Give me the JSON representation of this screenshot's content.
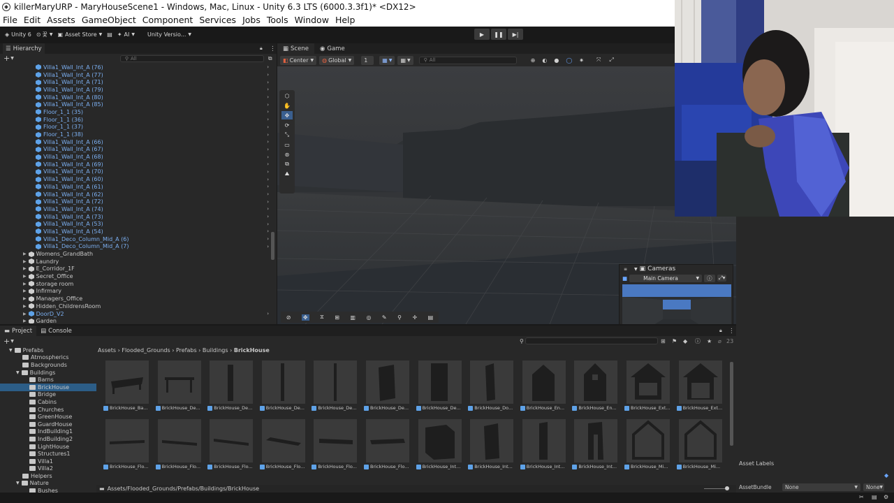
{
  "window": {
    "title": "killerMaryURP - MaryHouseScene1 - Windows, Mac, Linux - Unity 6.3 LTS (6000.3.3f1)* <DX12>"
  },
  "menu": [
    "File",
    "Edit",
    "Assets",
    "GameObject",
    "Component",
    "Services",
    "Jobs",
    "Tools",
    "Window",
    "Help"
  ],
  "toolbar": {
    "account": "Unity 6",
    "account_extra": "꽃",
    "asset_store": "Asset Store",
    "ai": "AI",
    "version_control": "Unity Versio..."
  },
  "hierarchy": {
    "tab": "Hierarchy",
    "search_placeholder": "All",
    "prefab_rows": [
      "Villa1_Wall_Int_A (76)",
      "Villa1_Wall_Int_A (77)",
      "Villa1_Wall_Int_A (71)",
      "Villa1_Wall_Int_A (79)",
      "Villa1_Wall_Int_A (80)",
      "Villa1_Wall_Int_A (85)",
      "Floor_1_1 (35)",
      "Floor_1_1 (36)",
      "Floor_1_1 (37)",
      "Floor_1_1 (38)",
      "Villa1_Wall_Int_A (66)",
      "Villa1_Wall_Int_A (67)",
      "Villa1_Wall_Int_A (68)",
      "Villa1_Wall_Int_A (69)",
      "Villa1_Wall_Int_A (70)",
      "Villa1_Wall_Int_A (60)",
      "Villa1_Wall_Int_A (61)",
      "Villa1_Wall_Int_A (62)",
      "Villa1_Wall_Int_A (72)",
      "Villa1_Wall_Int_A (74)",
      "Villa1_Wall_Int_A (73)",
      "Villa1_Wall_Int_A (53)",
      "Villa1_Wall_Int_A (54)",
      "Villa1_Deco_Column_Mid_A (6)",
      "Villa1_Deco_Column_Mid_A (7)"
    ],
    "object_rows": [
      "Womens_GrandBath",
      "Laundry",
      "E_Corridor_1F",
      "Secret_Office",
      "storage room",
      "Infirmary",
      "Managers_Office",
      "Hidden_ChildrensRoom"
    ],
    "door_row": "DoorD_V2",
    "garden_row": "Garden"
  },
  "scene": {
    "tabs": [
      "Scene",
      "Game"
    ],
    "pivot": "Center",
    "space": "Global",
    "grid_snap": "1",
    "search_placeholder": "All"
  },
  "cameras": {
    "title": "Cameras",
    "selected": "Main Camera"
  },
  "project": {
    "tabs": [
      "Project",
      "Console"
    ],
    "count": "23",
    "tree": [
      {
        "label": "Prefabs",
        "indent": 0,
        "open": true
      },
      {
        "label": "Atmospherics",
        "indent": 1
      },
      {
        "label": "Backgrounds",
        "indent": 1
      },
      {
        "label": "Buildings",
        "indent": 1,
        "open": true
      },
      {
        "label": "Barns",
        "indent": 2
      },
      {
        "label": "BrickHouse",
        "indent": 2,
        "selected": true
      },
      {
        "label": "Bridge",
        "indent": 2
      },
      {
        "label": "Cabins",
        "indent": 2
      },
      {
        "label": "Churches",
        "indent": 2
      },
      {
        "label": "GreenHouse",
        "indent": 2
      },
      {
        "label": "GuardHouse",
        "indent": 2
      },
      {
        "label": "IndBuilding1",
        "indent": 2
      },
      {
        "label": "IndBuilding2",
        "indent": 2
      },
      {
        "label": "LightHouse",
        "indent": 2
      },
      {
        "label": "Structures1",
        "indent": 2
      },
      {
        "label": "Villa1",
        "indent": 2
      },
      {
        "label": "Villa2",
        "indent": 2
      },
      {
        "label": "Helpers",
        "indent": 1
      },
      {
        "label": "Nature",
        "indent": 1,
        "open": true
      },
      {
        "label": "Bushes",
        "indent": 2
      }
    ],
    "breadcrumb": [
      "Assets",
      "Flooded_Grounds",
      "Prefabs",
      "Buildings"
    ],
    "breadcrumb_current": "BrickHouse",
    "assets_row1": [
      "BrickHouse_Ba...",
      "BrickHouse_De...",
      "BrickHouse_De...",
      "BrickHouse_De...",
      "BrickHouse_De...",
      "BrickHouse_De...",
      "BrickHouse_De...",
      "BrickHouse_Do...",
      "BrickHouse_En...",
      "BrickHouse_En...",
      "BrickHouse_Ext...",
      "BrickHouse_Ext..."
    ],
    "assets_row2": [
      "BrickHouse_Flo...",
      "BrickHouse_Flo...",
      "BrickHouse_Flo...",
      "BrickHouse_Flo...",
      "BrickHouse_Flo...",
      "BrickHouse_Flo...",
      "BrickHouse_Int...",
      "BrickHouse_Int...",
      "BrickHouse_Int...",
      "BrickHouse_Int...",
      "BrickHouse_Mi...",
      "BrickHouse_Mi..."
    ],
    "path": "Assets/Flooded_Grounds/Prefabs/Buildings/BrickHouse"
  },
  "inspector": {
    "asset_labels": "Asset Labels",
    "assetbundle_label": "AssetBundle",
    "assetbundle_value": "None",
    "variant_value": "None"
  },
  "colors": {
    "prefab_blue": "#7cb0f2",
    "selection": "#2c5d87",
    "panel": "#282828",
    "background": "#191919"
  }
}
